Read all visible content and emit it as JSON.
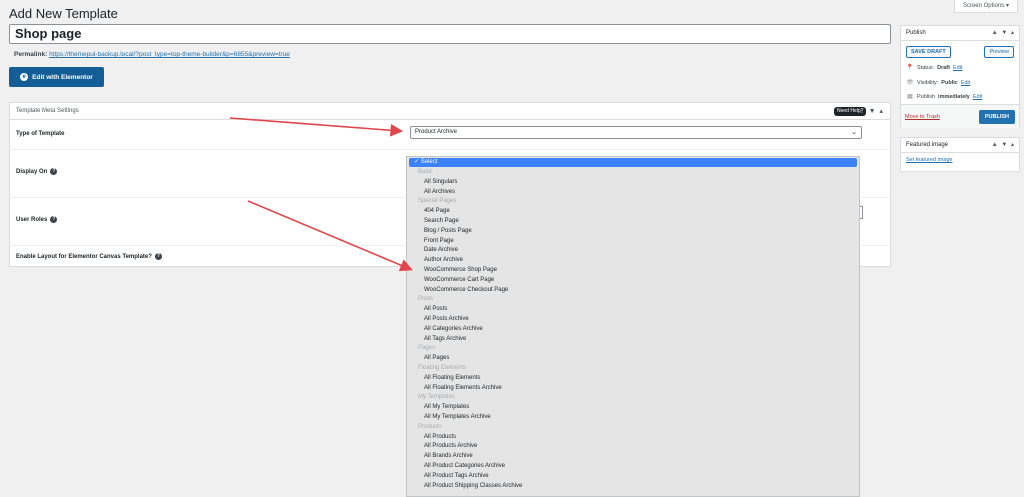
{
  "page_title": "Add New Template",
  "screen_options": "Screen Options ▾",
  "title_value": "Shop page",
  "permalink": {
    "label": "Permalink:",
    "url": "https://themepul-backup.local/?post_type=top-theme-builder&p=6855&preview=true"
  },
  "elementor_button": "Edit with Elementor",
  "meta_box": {
    "title": "Template Meta Settings",
    "help": "Need Help?",
    "controls": "▲ ▼ ▴",
    "rows": {
      "type_label": "Type of Template",
      "display_label": "Display On",
      "roles_label": "User Roles",
      "canvas_label": "Enable Layout for Elementor Canvas Template?"
    },
    "type_value": "Product Archive"
  },
  "dropdown": {
    "selected": "✓ Select",
    "items": [
      {
        "label": "Basic",
        "group": true
      },
      {
        "label": "All Singulars"
      },
      {
        "label": "All Archives"
      },
      {
        "label": "Special Pages",
        "group": true
      },
      {
        "label": "404 Page"
      },
      {
        "label": "Search Page"
      },
      {
        "label": "Blog / Posts Page"
      },
      {
        "label": "Front Page"
      },
      {
        "label": "Date Archive"
      },
      {
        "label": "Author Archive"
      },
      {
        "label": "WooCommerce Shop Page"
      },
      {
        "label": "WooCommerce Cart Page"
      },
      {
        "label": "WooCommerce Checkout Page"
      },
      {
        "label": "Posts",
        "group": true
      },
      {
        "label": "All Posts"
      },
      {
        "label": "All Posts Archive"
      },
      {
        "label": "All Categories Archive"
      },
      {
        "label": "All Tags Archive"
      },
      {
        "label": "Pages",
        "group": true
      },
      {
        "label": "All Pages"
      },
      {
        "label": "Floating Elements",
        "group": true
      },
      {
        "label": "All Floating Elements"
      },
      {
        "label": "All Floating Elements Archive"
      },
      {
        "label": "My Templates",
        "group": true
      },
      {
        "label": "All My Templates"
      },
      {
        "label": "All My Templates Archive"
      },
      {
        "label": "Products",
        "group": true
      },
      {
        "label": "All Products"
      },
      {
        "label": "All Products Archive"
      },
      {
        "label": "All Brands Archive"
      },
      {
        "label": "All Product Categories Archive"
      },
      {
        "label": "All Product Tags Archive"
      },
      {
        "label": "All Product Shipping Classes Archive"
      }
    ]
  },
  "publish": {
    "title": "Publish",
    "controls": "▲ ▼ ▴",
    "save_draft": "SAVE DRAFT",
    "preview": "Preview",
    "status_label": "Status:",
    "status_value": "Draft",
    "visibility_label": "Visibility:",
    "visibility_value": "Public",
    "publish_label": "Publish",
    "publish_value": "immediately",
    "edit": "Edit",
    "trash": "Move to Trash",
    "publish_button": "PUBLISH"
  },
  "featured": {
    "title": "Featured image",
    "controls": "▲ ▼ ▴",
    "link": "Set featured image"
  },
  "colors": {
    "accent": "#2271b1",
    "arrow": "#e0474c",
    "selected": "#3b82f6"
  }
}
